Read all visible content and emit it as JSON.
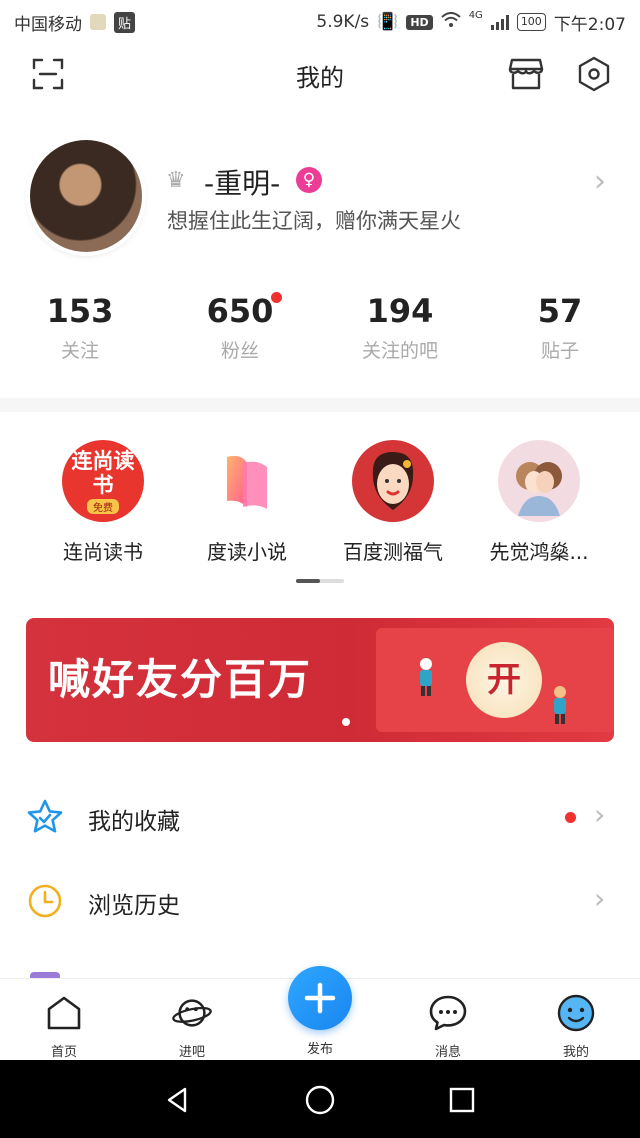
{
  "status_bar": {
    "carrier": "中国移动",
    "tie_badge": "贴",
    "speed": "5.9K/s",
    "hd": "HD",
    "network": "4G",
    "battery": "100",
    "time": "下午2:07"
  },
  "header": {
    "title": "我的",
    "icons": [
      "scan-icon",
      "store-icon",
      "settings-icon"
    ]
  },
  "profile": {
    "username": "-重明-",
    "signature": "想握住此生辽阔，赠你满天星火",
    "gender_symbol": "♀",
    "stats": [
      {
        "value": "153",
        "label": "关注"
      },
      {
        "value": "650",
        "label": "粉丝"
      },
      {
        "value": "194",
        "label": "关注的吧"
      },
      {
        "value": "57",
        "label": "贴子"
      }
    ]
  },
  "apps": [
    {
      "label": "连尚读书",
      "icon_text": "连尚读书",
      "badge": "免费"
    },
    {
      "label": "度读小说"
    },
    {
      "label": "百度测福气"
    },
    {
      "label": "先觉鸿燊..."
    }
  ],
  "banner": {
    "text": "喊好友分百万",
    "button": "开"
  },
  "menu": [
    {
      "label": "我的收藏",
      "has_dot": true
    },
    {
      "label": "浏览历史",
      "has_dot": false
    }
  ],
  "bottom_nav": [
    {
      "label": "首页"
    },
    {
      "label": "进吧"
    },
    {
      "label": "发布"
    },
    {
      "label": "消息"
    },
    {
      "label": "我的"
    }
  ],
  "colors": {
    "accent_blue": "#1e9bf7",
    "red_dot": "#f0312f",
    "banner_red": "#d4323d",
    "gender_pink": "#ec3d96"
  }
}
